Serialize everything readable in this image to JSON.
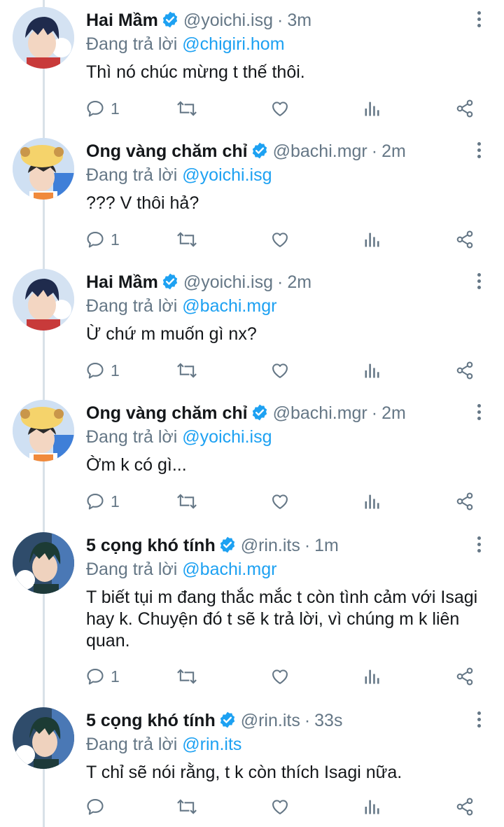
{
  "colors": {
    "accent": "#1da1f2",
    "muted": "#657786",
    "text": "#14171a",
    "thread_line": "#d9e1e8"
  },
  "replying_prefix": "Đang trả lời ",
  "tweets": [
    {
      "name": "Hai Mầm",
      "handle": "@yoichi.isg",
      "dot": "·",
      "time": "3m",
      "replying_to": "@chigiri.hom",
      "text": "Thì nó chúc mừng t thế thôi.",
      "reply_count": "1",
      "avatar": "avatar-boy-dark-hair"
    },
    {
      "name": "Ong vàng chăm chỉ",
      "handle": "@bachi.mgr",
      "dot": "·",
      "time": "2m",
      "replying_to": "@yoichi.isg",
      "text": "??? V thôi hả?",
      "reply_count": "1",
      "avatar": "avatar-boy-yellow-hat"
    },
    {
      "name": "Hai Mầm",
      "handle": "@yoichi.isg",
      "dot": "·",
      "time": "2m",
      "replying_to": "@bachi.mgr",
      "text": "Ừ chứ m muốn gì nx?",
      "reply_count": "1",
      "avatar": "avatar-boy-dark-hair"
    },
    {
      "name": "Ong vàng chăm chỉ",
      "handle": "@bachi.mgr",
      "dot": "·",
      "time": "2m",
      "replying_to": "@yoichi.isg",
      "text": "Ờm k có gì...",
      "reply_count": "1",
      "avatar": "avatar-boy-yellow-hat"
    },
    {
      "name": "5 cọng khó tính",
      "handle": "@rin.its",
      "dot": "·",
      "time": "1m",
      "replying_to": "@bachi.mgr",
      "text": "T biết tụi m đang thắc mắc t còn tình cảm với Isagi hay k. Chuyện đó t sẽ k trả lời, vì chúng m k liên quan.",
      "reply_count": "1",
      "avatar": "avatar-boy-green-hair"
    },
    {
      "name": "5 cọng khó tính",
      "handle": "@rin.its",
      "dot": "·",
      "time": "33s",
      "replying_to": "@rin.its",
      "text": "T chỉ sẽ nói rằng, t k còn thích Isagi nữa.",
      "reply_count": "",
      "avatar": "avatar-boy-green-hair"
    }
  ]
}
